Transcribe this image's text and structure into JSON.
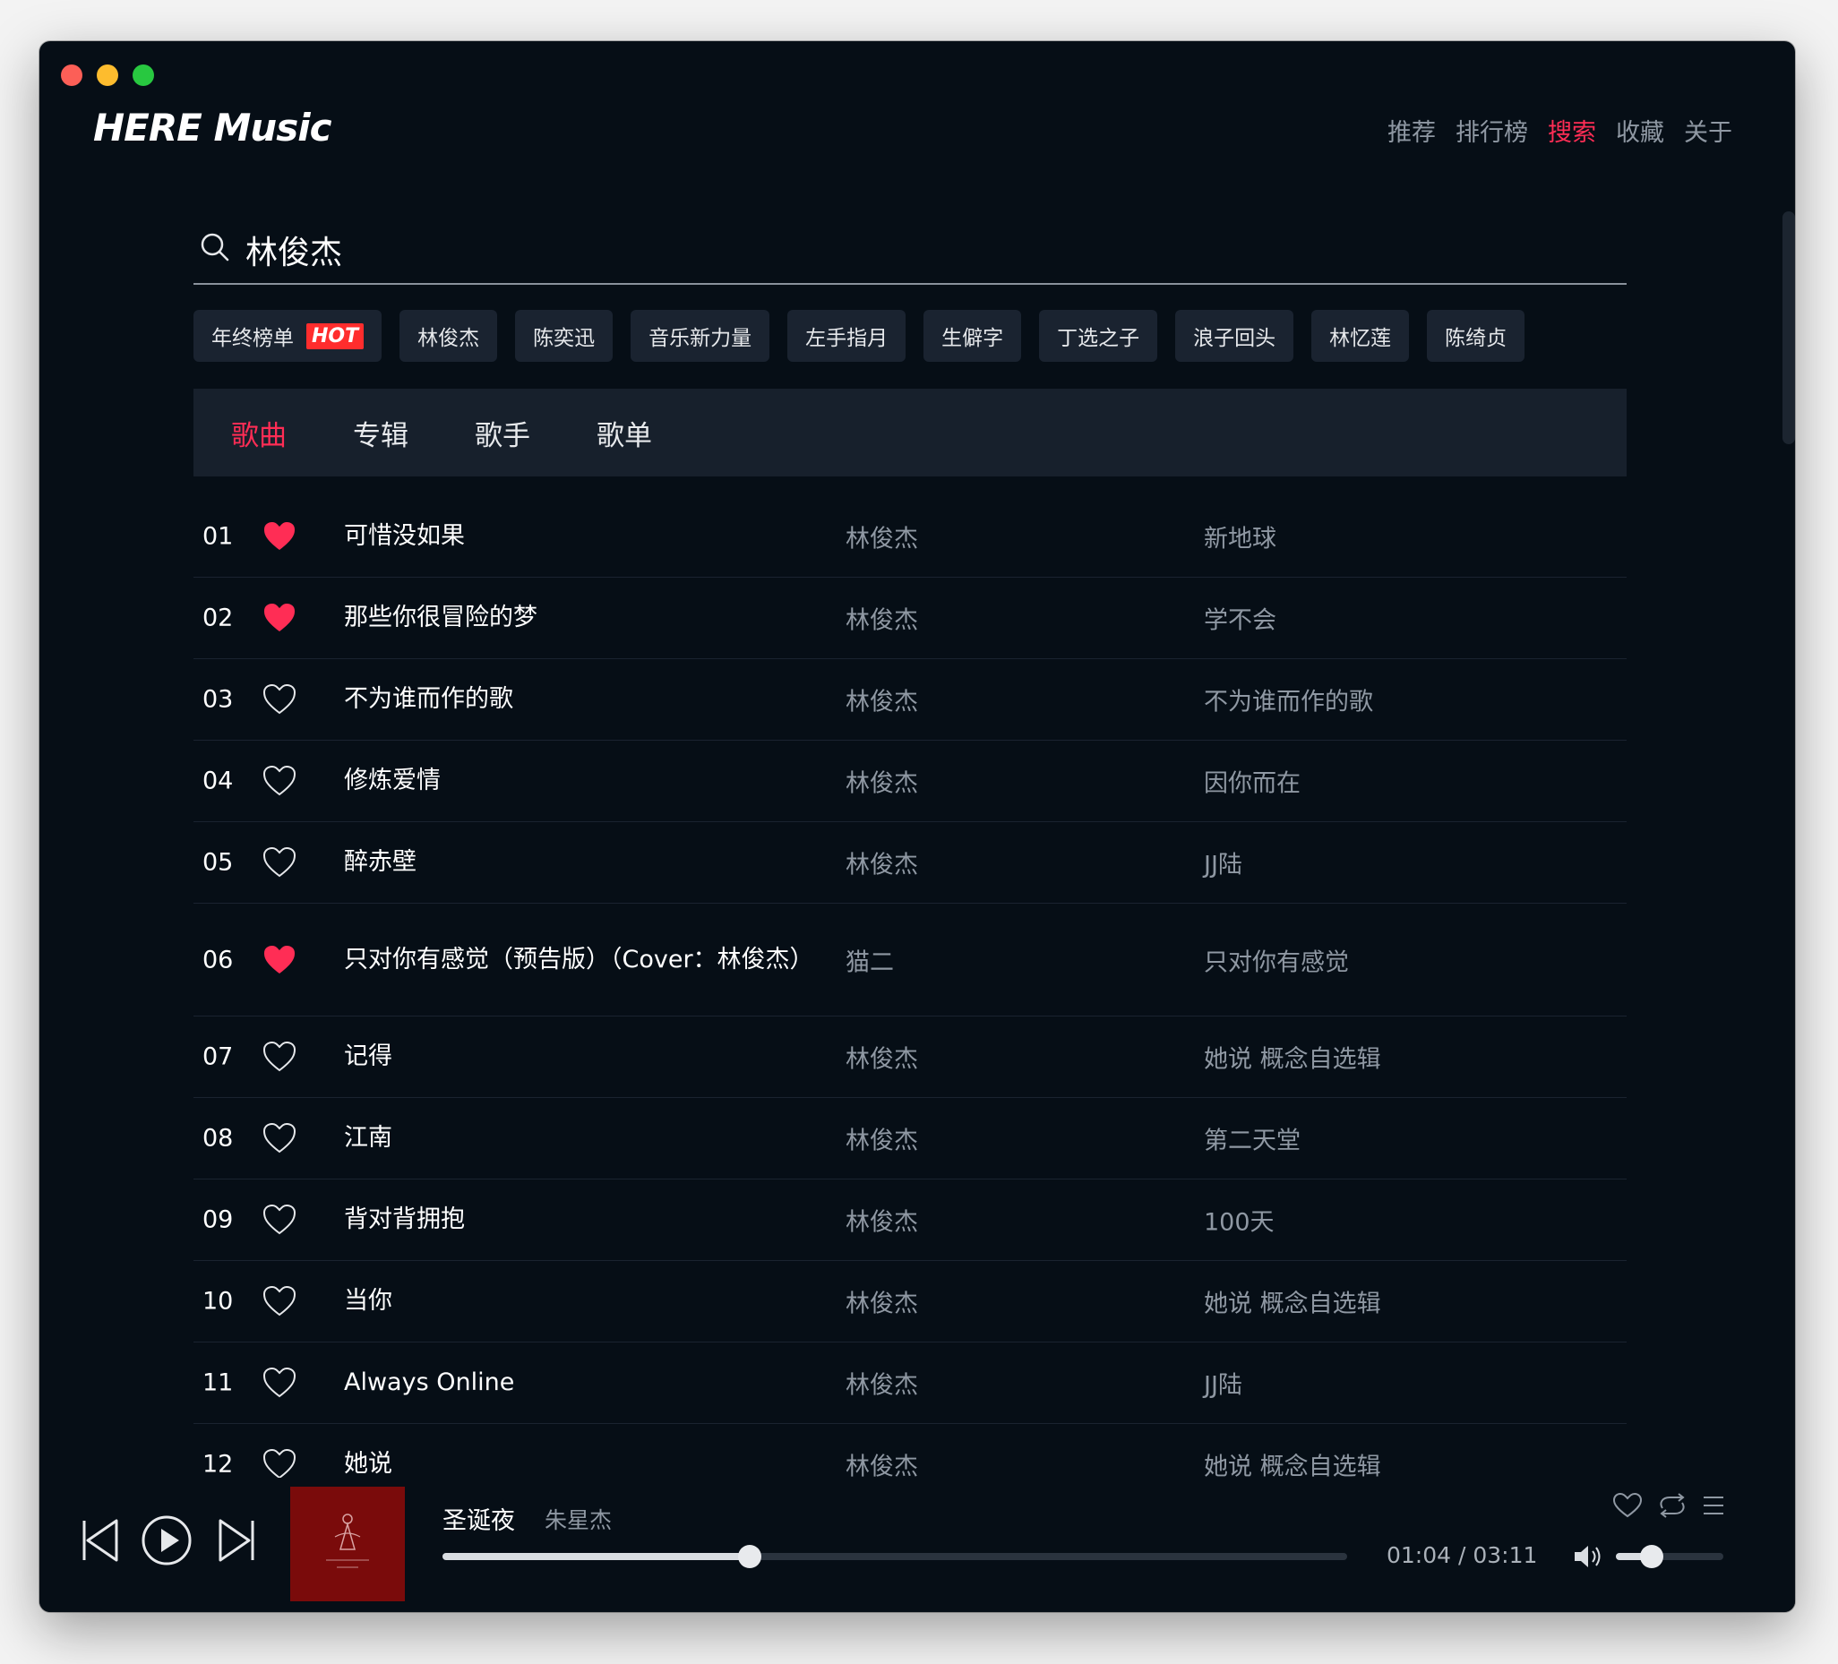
{
  "app": {
    "logo": "HERE Music"
  },
  "nav": [
    {
      "label": "推荐",
      "active": false
    },
    {
      "label": "排行榜",
      "active": false
    },
    {
      "label": "搜索",
      "active": true
    },
    {
      "label": "收藏",
      "active": false
    },
    {
      "label": "关于",
      "active": false
    }
  ],
  "search": {
    "value": "林俊杰",
    "placeholder": ""
  },
  "hot_tags": [
    {
      "label": "年终榜单",
      "badge": "HOT"
    },
    {
      "label": "林俊杰"
    },
    {
      "label": "陈奕迅"
    },
    {
      "label": "音乐新力量"
    },
    {
      "label": "左手指月"
    },
    {
      "label": "生僻字"
    },
    {
      "label": "丁选之子"
    },
    {
      "label": "浪子回头"
    },
    {
      "label": "林忆莲"
    },
    {
      "label": "陈绮贞"
    }
  ],
  "tabs": [
    {
      "label": "歌曲",
      "active": true
    },
    {
      "label": "专辑",
      "active": false
    },
    {
      "label": "歌手",
      "active": false
    },
    {
      "label": "歌单",
      "active": false
    }
  ],
  "songs": [
    {
      "num": "01",
      "liked": true,
      "title": "可惜没如果",
      "artist": "林俊杰",
      "album": "新地球"
    },
    {
      "num": "02",
      "liked": true,
      "title": "那些你很冒险的梦",
      "artist": "林俊杰",
      "album": "学不会"
    },
    {
      "num": "03",
      "liked": false,
      "title": "不为谁而作的歌",
      "artist": "林俊杰",
      "album": "不为谁而作的歌"
    },
    {
      "num": "04",
      "liked": false,
      "title": "修炼爱情",
      "artist": "林俊杰",
      "album": "因你而在"
    },
    {
      "num": "05",
      "liked": false,
      "title": "醉赤壁",
      "artist": "林俊杰",
      "album": "JJ陆"
    },
    {
      "num": "06",
      "liked": true,
      "title": "只对你有感觉（预告版）（Cover：林俊杰）",
      "artist": "猫二",
      "album": "只对你有感觉",
      "tall": true
    },
    {
      "num": "07",
      "liked": false,
      "title": "记得",
      "artist": "林俊杰",
      "album": "她说 概念自选辑"
    },
    {
      "num": "08",
      "liked": false,
      "title": "江南",
      "artist": "林俊杰",
      "album": "第二天堂"
    },
    {
      "num": "09",
      "liked": false,
      "title": "背对背拥抱",
      "artist": "林俊杰",
      "album": "100天"
    },
    {
      "num": "10",
      "liked": false,
      "title": "当你",
      "artist": "林俊杰",
      "album": "她说 概念自选辑"
    },
    {
      "num": "11",
      "liked": false,
      "title": "Always Online",
      "artist": "林俊杰",
      "album": "JJ陆"
    },
    {
      "num": "12",
      "liked": false,
      "title": "她说",
      "artist": "林俊杰",
      "album": "她说 概念自选辑"
    }
  ],
  "player": {
    "title": "圣诞夜",
    "artist": "朱星杰",
    "time_current": "01:04",
    "time_total": "03:11",
    "time_display": "01:04 / 03:11",
    "progress": 0.34,
    "volume": 0.33
  },
  "icons": {
    "prev": "skip-back-icon",
    "play": "play-icon",
    "next": "skip-forward-icon",
    "like": "heart-icon",
    "loop": "loop-icon",
    "playlist": "playlist-icon",
    "volume": "volume-icon",
    "search": "search-icon"
  },
  "colors": {
    "accent": "#ff2d55",
    "background": "#060e16",
    "tag_bg": "#1a2330",
    "tab_bar_bg": "#17202c",
    "secondary_text": "#8f98a3"
  }
}
